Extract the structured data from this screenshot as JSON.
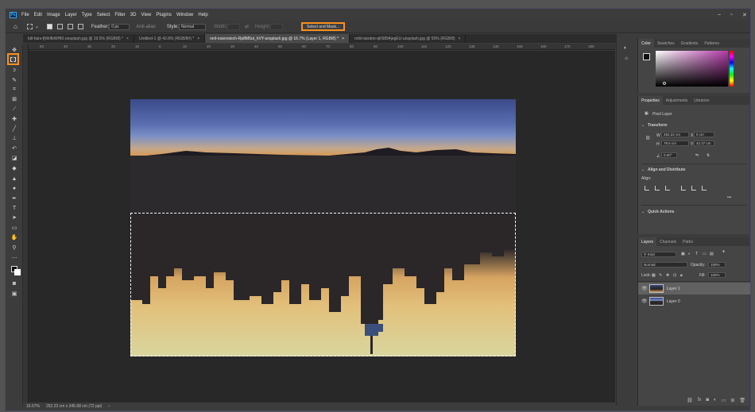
{
  "app": {
    "logo": "Ps"
  },
  "menu": [
    "File",
    "Edit",
    "Image",
    "Layer",
    "Type",
    "Select",
    "Filter",
    "3D",
    "View",
    "Plugins",
    "Window",
    "Help"
  ],
  "options": {
    "feather_label": "Feather:",
    "feather_value": "0 px",
    "antialias_label": "Anti-alias",
    "style_label": "Style:",
    "style_value": "Normal",
    "width_label": "Width:",
    "height_label": "Height:",
    "select_and_mask": "Select and Mask..."
  },
  "tabs": [
    "bill-fairs-fjWrlIbWHl0-unsplash.jpg @ 19.5% (RGB/8) *",
    "Untitled-1 @ 42.8% (RGB/8#) *",
    "neil-rosenstech-Rp8M5ut_hVY-unsplash.jpg @ 16.7% (Layer 1, RGB/8) *",
    "rohit-tandon-qK6894jegEU-unsplash.jpg @ 50% (RGB/8)"
  ],
  "rulers": [
    "50",
    "40",
    "30",
    "20",
    "10",
    "0",
    "10",
    "20",
    "30",
    "40",
    "50",
    "60",
    "70",
    "80",
    "90",
    "100",
    "110",
    "120",
    "130",
    "140",
    "150",
    "160",
    "170",
    "180"
  ],
  "status": {
    "zoom": "16.67%",
    "dimensions": "252.23 cm x 345.68 cm (72 ppi)"
  },
  "color_panel": {
    "tabs": [
      "Color",
      "Swatches",
      "Gradients",
      "Patterns"
    ]
  },
  "properties": {
    "tabs": [
      "Properties",
      "Adjustments",
      "Libraries"
    ],
    "layer_type": "Pixel Layer",
    "transform_heading": "Transform",
    "w_label": "W",
    "w_value": "252.22 cm",
    "x_label": "X",
    "x_value": "0 cm",
    "h_label": "H",
    "h_value": "79.5 cm",
    "y_label": "Y",
    "y_value": "42.37 cm",
    "angle_value": "0.00°",
    "align_heading": "Align and Distribute",
    "align_label": "Align:",
    "quick_actions": "Quick Actions"
  },
  "layers": {
    "tabs": [
      "Layers",
      "Channels",
      "Paths"
    ],
    "filter": "Kind",
    "blend_mode": "Normal",
    "opacity_label": "Opacity:",
    "opacity": "100%",
    "lock_label": "Lock:",
    "fill_label": "Fill:",
    "fill": "100%",
    "items": [
      "Layer 1",
      "Layer 0"
    ]
  },
  "colors": {
    "accent_highlight": "#f7901e",
    "app_background": "#3c3c3c",
    "canvas_background": "#282828"
  }
}
